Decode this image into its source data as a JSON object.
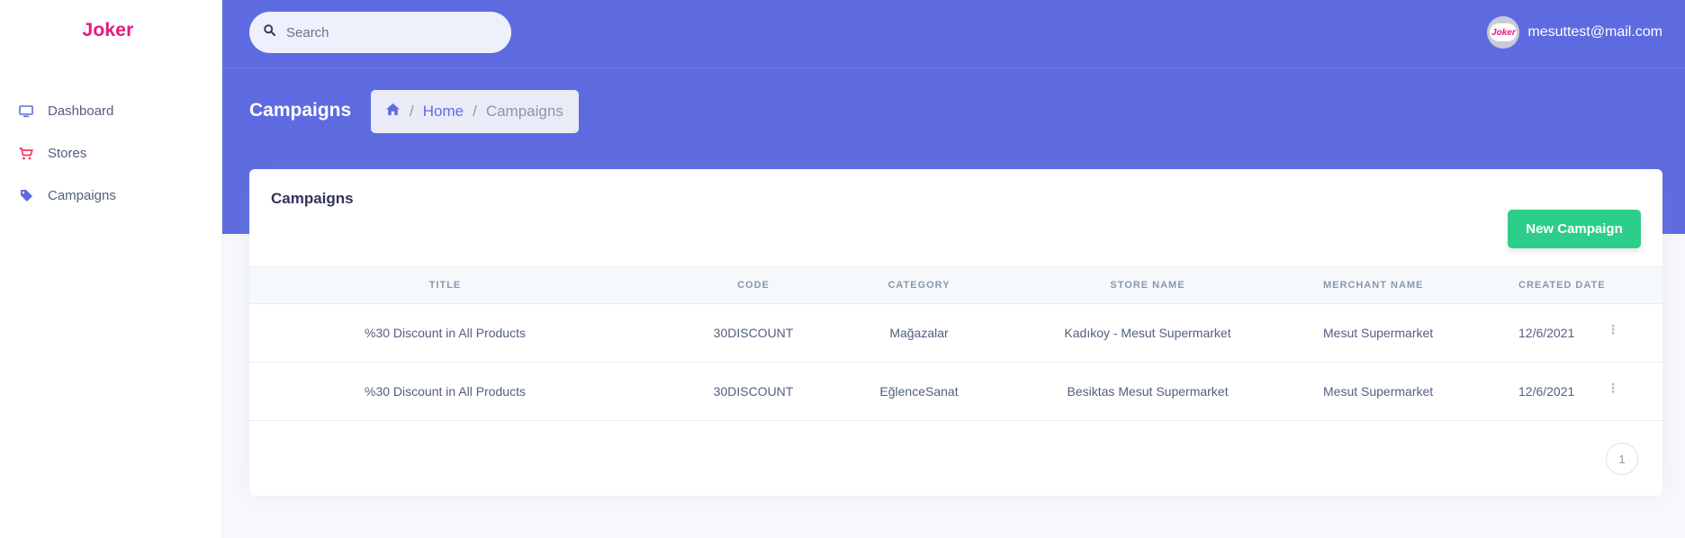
{
  "app": {
    "brand": "Joker"
  },
  "sidebar": {
    "items": [
      {
        "label": "Dashboard",
        "icon": "monitor-icon",
        "color": "#5e6be0"
      },
      {
        "label": "Stores",
        "icon": "cart-icon",
        "color": "#f5365c"
      },
      {
        "label": "Campaigns",
        "icon": "tag-icon",
        "color": "#5e6be0"
      }
    ]
  },
  "header": {
    "search_placeholder": "Search",
    "user_email": "mesuttest@mail.com",
    "avatar_text": "Joker"
  },
  "page": {
    "title": "Campaigns",
    "breadcrumb": {
      "home": "Home",
      "current": "Campaigns",
      "separator": "/"
    }
  },
  "card": {
    "title": "Campaigns",
    "new_button": "New Campaign",
    "columns": [
      "Title",
      "Code",
      "Category",
      "Store Name",
      "Merchant Name",
      "Created Date"
    ],
    "rows": [
      {
        "title": "%30 Discount in All Products",
        "code": "30DISCOUNT",
        "category": "Mağazalar",
        "store": "Kadıkoy - Mesut Supermarket",
        "merchant": "Mesut Supermarket",
        "date": "12/6/2021"
      },
      {
        "title": "%30 Discount in All Products",
        "code": "30DISCOUNT",
        "category": "EğlenceSanat",
        "store": "Besiktas Mesut Supermarket",
        "merchant": "Mesut Supermarket",
        "date": "12/6/2021"
      }
    ],
    "pagination": {
      "current_page": "1"
    }
  },
  "colors": {
    "primary": "#5e6be0",
    "success": "#2dce89",
    "brand": "#e6197d"
  }
}
